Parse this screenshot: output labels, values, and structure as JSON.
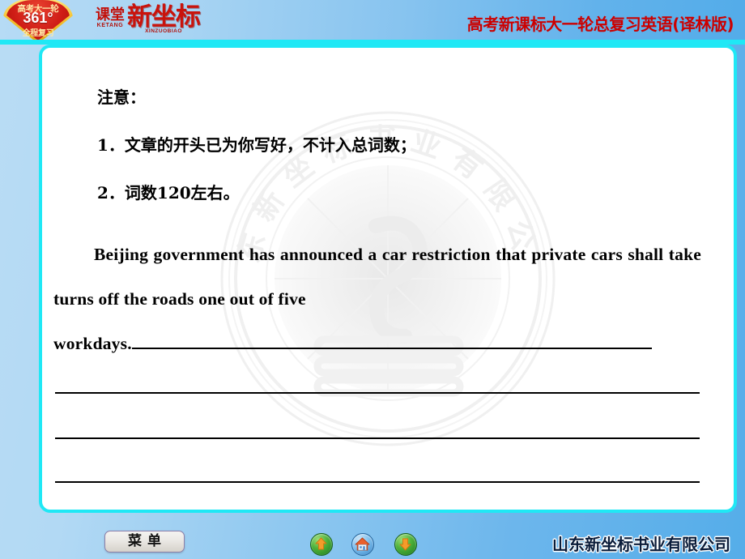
{
  "header": {
    "badge": {
      "line1": "高考大一轮",
      "line2": "361°",
      "line3": "全程复习"
    },
    "brand": {
      "ketang": "课堂",
      "ketang_pinyin": "KETANG",
      "xinzuobiao": "新坐标",
      "xinzuobiao_pinyin": "XINZUOBIAO"
    },
    "title": "高考新课标大一轮总复习英语(译林版)"
  },
  "content": {
    "note_heading": "注意：",
    "note_item_1": "1．文章的开头已为你写好，不计入总词数；",
    "note_item_2": "2．词数120左右。",
    "paragraph": "Beijing government has announced a car restriction that private cars shall take turns off the roads one out of five",
    "paragraph_last_word": "workdays.",
    "blank_line_count": 3
  },
  "watermark": {
    "seal_text": "山东新坐标书业有限公司"
  },
  "footer": {
    "menu_label": "菜单",
    "nav": [
      {
        "name": "previous-slide",
        "icon": "up-arrow-icon"
      },
      {
        "name": "home-slide",
        "icon": "home-icon"
      },
      {
        "name": "next-slide",
        "icon": "down-arrow-icon"
      }
    ],
    "company": "山东新坐标书业有限公司"
  },
  "colors": {
    "background_left": "#b9dcf4",
    "background_right": "#55ade9",
    "panel_border": "#1fe8f5",
    "panel_background": "#ffffff",
    "title_red": "#cc0000",
    "brand_red": "#c9130c",
    "badge_red": "#cf1d16",
    "badge_gold": "#f5c230",
    "company_text": "#0a1c3a",
    "nav_green": "#4fb23a",
    "nav_blue": "#7fc0ee"
  }
}
